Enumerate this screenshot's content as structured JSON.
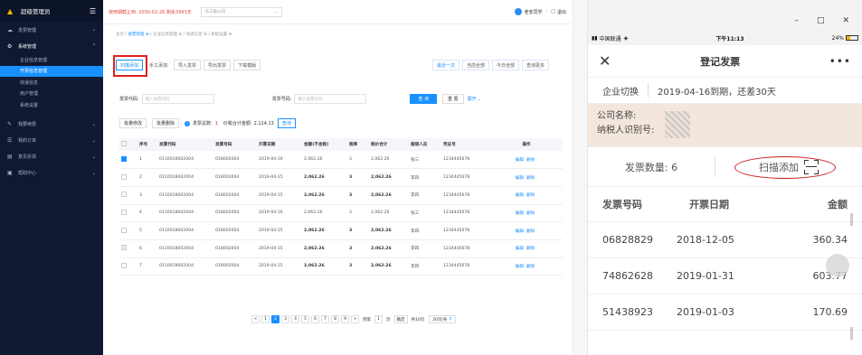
{
  "admin": {
    "brand": "超级管理员",
    "menu": [
      {
        "label": "发票管理",
        "icon": "cloud-icon"
      },
      {
        "label": "系统管理",
        "icon": "gear-icon",
        "open": true,
        "sub": [
          "企业信息管理",
          "开票信息管理",
          "快递信息",
          "用户管理",
          "系统设置"
        ],
        "active": 1
      },
      {
        "label": "我要续费",
        "icon": "edit-icon"
      },
      {
        "label": "我的订单",
        "icon": "list-icon"
      },
      {
        "label": "意见反馈",
        "icon": "chat-icon"
      },
      {
        "label": "帮助中心",
        "icon": "help-icon"
      }
    ],
    "header": {
      "warning": "使用期截止到: 2030-02-26 剩余3993天",
      "company_select": "东三省公司",
      "user": "老安同学",
      "logout": "退出"
    },
    "breadcrumb": [
      "主页",
      "发票管理",
      "企业信息管理",
      "快递信息",
      "系统设置"
    ],
    "toolbar": [
      "扫描添加",
      "手工添加",
      "导入发票",
      "导出发票",
      "下载模版"
    ],
    "range_tabs": [
      "最近一次",
      "当前全部",
      "今日全部",
      "查询更多"
    ],
    "filter": {
      "code_label": "发票代码:",
      "code_placeholder": "输入发票代码",
      "number_label": "发票号码:",
      "number_placeholder": "输入发票号码",
      "query": "查 询",
      "reset": "重 置",
      "expand": "展开"
    },
    "actions": {
      "batch_edit": "批量修改",
      "batch_delete": "批量删除",
      "total_label": "发票总数:",
      "total": "1",
      "sum_label": "价税合计金额:",
      "sum": "2,124.13",
      "query": "查询"
    },
    "columns": [
      "序号",
      "发票代码",
      "发票号码",
      "开票日期",
      "金额(不含税)",
      "税率",
      "税价合计",
      "报销人员",
      "凭证号",
      "操作"
    ],
    "rows": [
      {
        "check": "on",
        "no": "1",
        "code": "0110018002004",
        "num": "018002004",
        "date": "2019-04-16",
        "amt": "2,062.26",
        "rate": "3",
        "total": "2,062.26",
        "person": "张三",
        "voucher": "1234445678",
        "bold": false
      },
      {
        "check": "",
        "no": "2",
        "code": "0110018002004",
        "num": "018002004",
        "date": "2019-04-15",
        "amt": "2,062.26",
        "rate": "3",
        "total": "2,062.26",
        "person": "李四",
        "voucher": "1234445678",
        "bold": true
      },
      {
        "check": "",
        "no": "3",
        "code": "0110018002004",
        "num": "018002004",
        "date": "2019-04-15",
        "amt": "2,062.26",
        "rate": "3",
        "total": "2,062.26",
        "person": "李四",
        "voucher": "1234445678",
        "bold": true
      },
      {
        "check": "",
        "no": "4",
        "code": "0110018002004",
        "num": "018002004",
        "date": "2019-04-16",
        "amt": "2,062.26",
        "rate": "3",
        "total": "2,062.26",
        "person": "张三",
        "voucher": "1234445678",
        "bold": false
      },
      {
        "check": "",
        "no": "5",
        "code": "0110018002004",
        "num": "018002004",
        "date": "2019-04-15",
        "amt": "2,062.26",
        "rate": "3",
        "total": "2,062.26",
        "person": "李四",
        "voucher": "1234445678",
        "bold": true
      },
      {
        "check": "dim",
        "no": "6",
        "code": "0110018002004",
        "num": "018002004",
        "date": "2019-04-15",
        "amt": "2,062.26",
        "rate": "3",
        "total": "2,062.26",
        "person": "李四",
        "voucher": "1234445678",
        "bold": true
      },
      {
        "check": "",
        "no": "7",
        "code": "0110018002004",
        "num": "018002004",
        "date": "2019-04-15",
        "amt": "2,062.26",
        "rate": "3",
        "total": "2,062.26",
        "person": "李四",
        "voucher": "1234445678",
        "bold": true
      }
    ],
    "row_ops": [
      "编辑",
      "删除"
    ],
    "pager": {
      "pages": [
        "1",
        "2",
        "3",
        "4",
        "5",
        "6",
        "7",
        "8",
        "9"
      ],
      "current": "2",
      "goto": "到第",
      "goto_val": "1",
      "page": "页",
      "confirm": "确定",
      "total_pages": "共10页",
      "size": "20页/条"
    }
  },
  "mobile": {
    "carrier": "中国联通",
    "time": "下午11:13",
    "battery": "24%",
    "title": "登记发票",
    "switch_label": "企业切换",
    "expiry": "2019-04-16到期，还差30天",
    "company_label": "公司名称:",
    "taxid_label": "纳税人识别号:",
    "count_label": "发票数量: 6",
    "scan_label": "扫描添加",
    "columns": [
      "发票号码",
      "开票日期",
      "金额"
    ],
    "rows": [
      {
        "num": "06828829",
        "date": "2018-12-05",
        "amt": "360.34"
      },
      {
        "num": "74862628",
        "date": "2019-01-31",
        "amt": "603.77"
      },
      {
        "num": "51438923",
        "date": "2019-01-03",
        "amt": "170.69"
      }
    ]
  },
  "colors": {
    "accent": "#1890ff",
    "sidebar": "#0f1a32",
    "annotation": "#e02020"
  }
}
